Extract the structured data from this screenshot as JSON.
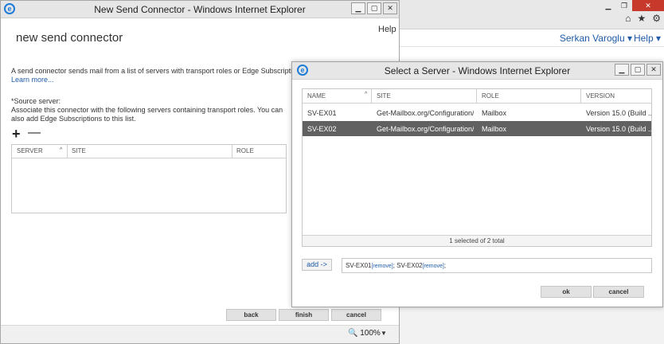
{
  "browser_bg": {
    "user": "Serkan Varoglu ▾",
    "help": "Help ▾",
    "tool_icons": [
      "⌂",
      "★",
      "⚙"
    ]
  },
  "main_window": {
    "title": "New Send Connector - Windows Internet Explorer",
    "help": "Help",
    "page_title": "new send connector",
    "description": "A send connector sends mail from a list of servers with transport roles or Edge Subscriptions.",
    "learn_more": "Learn more...",
    "source_server_label": "*Source server:",
    "associate_text": "Associate this connector with the following servers containing transport roles. You can also add Edge Subscriptions to this list.",
    "add_symbol": "+",
    "remove_symbol": "—",
    "columns": [
      "SERVER",
      "SITE",
      "ROLE"
    ],
    "buttons": {
      "back": "back",
      "finish": "finish",
      "cancel": "cancel"
    },
    "zoom": "100%",
    "zoom_dropdown": "▼"
  },
  "dialog": {
    "title": "Select a Server - Windows Internet Explorer",
    "columns": [
      "NAME",
      "SITE",
      "ROLE",
      "VERSION"
    ],
    "rows": [
      {
        "name": "SV-EX01",
        "site": "Get-Mailbox.org/Configuration/...",
        "role": "Mailbox",
        "version": "Version 15.0 (Build ...",
        "selected": false
      },
      {
        "name": "SV-EX02",
        "site": "Get-Mailbox.org/Configuration/...",
        "role": "Mailbox",
        "version": "Version 15.0 (Build ...",
        "selected": true
      }
    ],
    "status": "1 selected of 2 total",
    "add_button": "add ->",
    "selected_items": [
      {
        "name": "SV-EX01",
        "remove": "[remove]"
      },
      {
        "name": "SV-EX02",
        "remove": "[remove]"
      }
    ],
    "ok": "ok",
    "cancel": "cancel"
  }
}
